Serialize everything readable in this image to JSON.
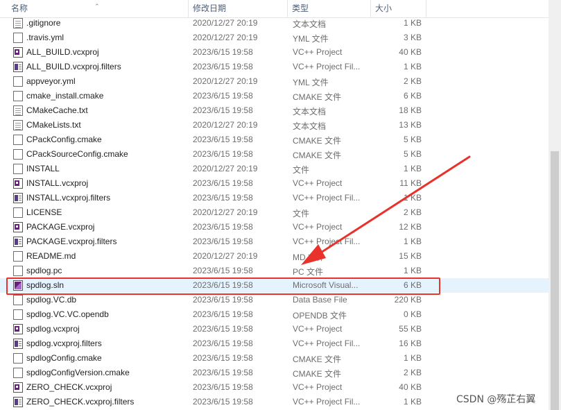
{
  "columns": {
    "name": "名称",
    "date": "修改日期",
    "type": "类型",
    "size": "大小"
  },
  "files": [
    {
      "name": ".gitignore",
      "date": "2020/12/27 20:19",
      "type": "文本文档",
      "size": "1 KB",
      "icon": "text-file-icon"
    },
    {
      "name": ".travis.yml",
      "date": "2020/12/27 20:19",
      "type": "YML 文件",
      "size": "3 KB",
      "icon": "blank-file-icon"
    },
    {
      "name": "ALL_BUILD.vcxproj",
      "date": "2023/6/15 19:58",
      "type": "VC++ Project",
      "size": "40 KB",
      "icon": "vcxproj-icon"
    },
    {
      "name": "ALL_BUILD.vcxproj.filters",
      "date": "2023/6/15 19:58",
      "type": "VC++ Project Fil...",
      "size": "1 KB",
      "icon": "filters-icon"
    },
    {
      "name": "appveyor.yml",
      "date": "2020/12/27 20:19",
      "type": "YML 文件",
      "size": "2 KB",
      "icon": "blank-file-icon"
    },
    {
      "name": "cmake_install.cmake",
      "date": "2023/6/15 19:58",
      "type": "CMAKE 文件",
      "size": "6 KB",
      "icon": "blank-file-icon"
    },
    {
      "name": "CMakeCache.txt",
      "date": "2023/6/15 19:58",
      "type": "文本文档",
      "size": "18 KB",
      "icon": "text-file-icon"
    },
    {
      "name": "CMakeLists.txt",
      "date": "2020/12/27 20:19",
      "type": "文本文档",
      "size": "13 KB",
      "icon": "text-file-icon"
    },
    {
      "name": "CPackConfig.cmake",
      "date": "2023/6/15 19:58",
      "type": "CMAKE 文件",
      "size": "5 KB",
      "icon": "blank-file-icon"
    },
    {
      "name": "CPackSourceConfig.cmake",
      "date": "2023/6/15 19:58",
      "type": "CMAKE 文件",
      "size": "5 KB",
      "icon": "blank-file-icon"
    },
    {
      "name": "INSTALL",
      "date": "2020/12/27 20:19",
      "type": "文件",
      "size": "1 KB",
      "icon": "blank-file-icon"
    },
    {
      "name": "INSTALL.vcxproj",
      "date": "2023/6/15 19:58",
      "type": "VC++ Project",
      "size": "11 KB",
      "icon": "vcxproj-icon"
    },
    {
      "name": "INSTALL.vcxproj.filters",
      "date": "2023/6/15 19:58",
      "type": "VC++ Project Fil...",
      "size": "1 KB",
      "icon": "filters-icon"
    },
    {
      "name": "LICENSE",
      "date": "2020/12/27 20:19",
      "type": "文件",
      "size": "2 KB",
      "icon": "blank-file-icon"
    },
    {
      "name": "PACKAGE.vcxproj",
      "date": "2023/6/15 19:58",
      "type": "VC++ Project",
      "size": "12 KB",
      "icon": "vcxproj-icon"
    },
    {
      "name": "PACKAGE.vcxproj.filters",
      "date": "2023/6/15 19:58",
      "type": "VC++ Project Fil...",
      "size": "1 KB",
      "icon": "filters-icon"
    },
    {
      "name": "README.md",
      "date": "2020/12/27 20:19",
      "type": "MD 文件",
      "size": "15 KB",
      "icon": "blank-file-icon"
    },
    {
      "name": "spdlog.pc",
      "date": "2023/6/15 19:58",
      "type": "PC 文件",
      "size": "1 KB",
      "icon": "blank-file-icon"
    },
    {
      "name": "spdlog.sln",
      "date": "2023/6/15 19:58",
      "type": "Microsoft Visual...",
      "size": "6 KB",
      "icon": "sln-icon",
      "selected": true
    },
    {
      "name": "spdlog.VC.db",
      "date": "2023/6/15 19:58",
      "type": "Data Base File",
      "size": "220 KB",
      "icon": "blank-file-icon"
    },
    {
      "name": "spdlog.VC.VC.opendb",
      "date": "2023/6/15 19:58",
      "type": "OPENDB 文件",
      "size": "0 KB",
      "icon": "blank-file-icon"
    },
    {
      "name": "spdlog.vcxproj",
      "date": "2023/6/15 19:58",
      "type": "VC++ Project",
      "size": "55 KB",
      "icon": "vcxproj-icon"
    },
    {
      "name": "spdlog.vcxproj.filters",
      "date": "2023/6/15 19:58",
      "type": "VC++ Project Fil...",
      "size": "16 KB",
      "icon": "filters-icon"
    },
    {
      "name": "spdlogConfig.cmake",
      "date": "2023/6/15 19:58",
      "type": "CMAKE 文件",
      "size": "1 KB",
      "icon": "blank-file-icon"
    },
    {
      "name": "spdlogConfigVersion.cmake",
      "date": "2023/6/15 19:58",
      "type": "CMAKE 文件",
      "size": "2 KB",
      "icon": "blank-file-icon"
    },
    {
      "name": "ZERO_CHECK.vcxproj",
      "date": "2023/6/15 19:58",
      "type": "VC++ Project",
      "size": "40 KB",
      "icon": "vcxproj-icon"
    },
    {
      "name": "ZERO_CHECK.vcxproj.filters",
      "date": "2023/6/15 19:58",
      "type": "VC++ Project Fil...",
      "size": "1 KB",
      "icon": "filters-icon"
    }
  ],
  "colors": {
    "selected_row": "#e5f3ff",
    "annotation_red": "#e8322b"
  },
  "watermark": "CSDN @殇芷右翼"
}
